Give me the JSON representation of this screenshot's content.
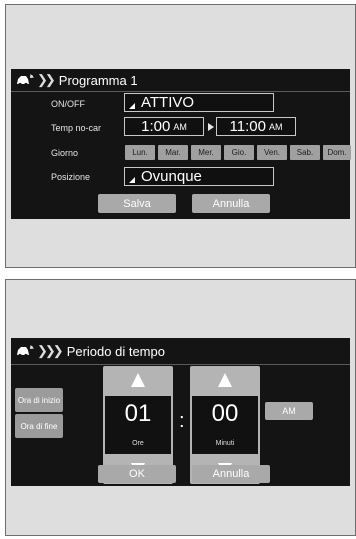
{
  "schedule": {
    "title": "Programma 1",
    "on_off_label": "ON/OFF",
    "on_off_value": "ATTIVO",
    "temp_label": "Temp no-car",
    "start_time": "1:00",
    "start_ampm": "AM",
    "end_time": "11:00",
    "end_ampm": "AM",
    "day_label": "Giorno",
    "days": [
      "Lun.",
      "Mar.",
      "Mer.",
      "Gio.",
      "Ven.",
      "Sab.",
      "Dom."
    ],
    "position_label": "Posizione",
    "position_value": "Ovunque",
    "save_label": "Salva",
    "cancel_label": "Annulla"
  },
  "time_period": {
    "title": "Periodo di tempo",
    "start_time_button": "Ora di inizio",
    "end_time_button": "Ora di fine",
    "hours_value": "01",
    "hours_unit": "Ore",
    "separator": ":",
    "minutes_value": "00",
    "minutes_unit": "Minuti",
    "ampm_label": "AM",
    "ok_label": "OK",
    "cancel_label": "Annulla"
  },
  "icons": {
    "car_settings": "car-remote-icon",
    "chevrons": "double-chevron-right-icon",
    "spin_up": "triangle-up-icon",
    "spin_down": "triangle-down-icon"
  }
}
